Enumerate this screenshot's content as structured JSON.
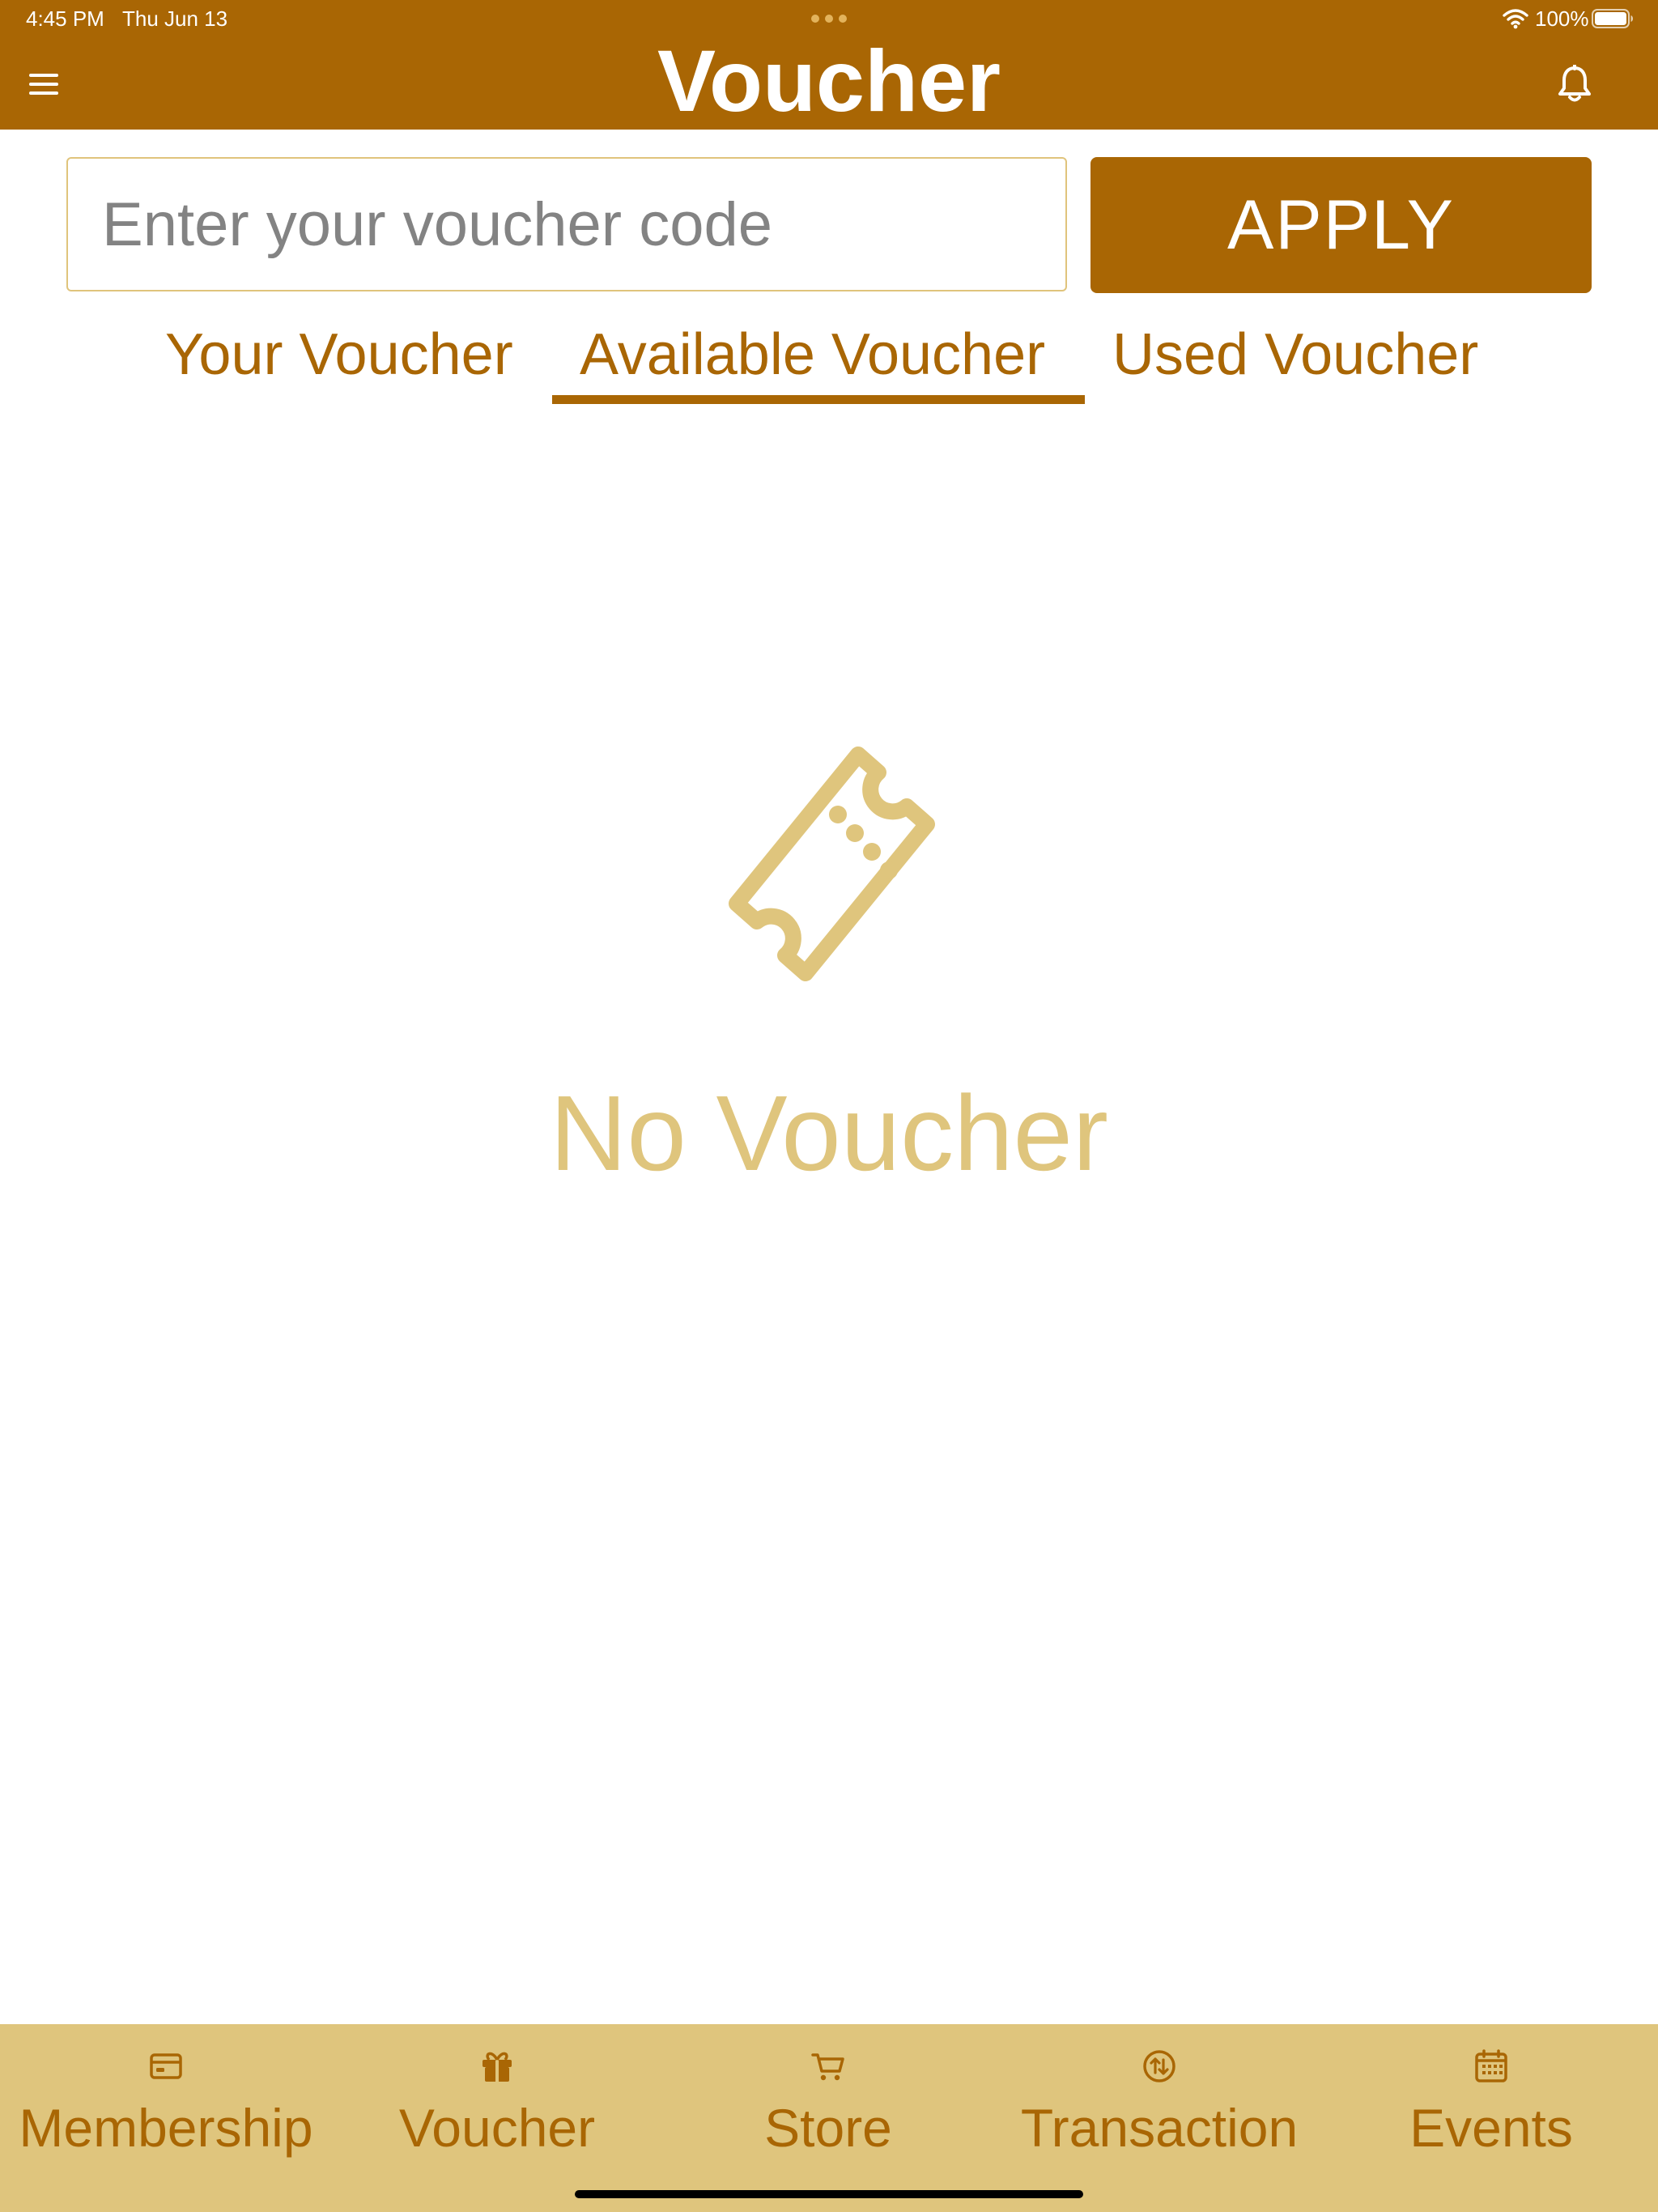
{
  "status_bar": {
    "time": "4:45 PM",
    "date": "Thu Jun 13",
    "battery": "100%"
  },
  "header": {
    "title": "Voucher",
    "menu_icon": "hamburger-menu-icon",
    "bell_icon": "bell-icon"
  },
  "code_entry": {
    "placeholder": "Enter your voucher code",
    "value": "",
    "apply_label": "APPLY"
  },
  "tabs": [
    {
      "label": "Your Voucher",
      "selected": false
    },
    {
      "label": "Available Voucher",
      "selected": true
    },
    {
      "label": "Used Voucher",
      "selected": false
    }
  ],
  "empty_state": {
    "icon": "ticket-icon",
    "message": "No Voucher"
  },
  "bottom_nav": [
    {
      "label": "Membership",
      "icon": "card-icon"
    },
    {
      "label": "Voucher",
      "icon": "gift-icon"
    },
    {
      "label": "Store",
      "icon": "cart-icon"
    },
    {
      "label": "Transaction",
      "icon": "exchange-icon"
    },
    {
      "label": "Events",
      "icon": "calendar-icon"
    }
  ],
  "colors": {
    "primary": "#A96604",
    "accent_light": "#DFC57D",
    "placeholder": "#838383",
    "background": "#FFFFFF"
  }
}
